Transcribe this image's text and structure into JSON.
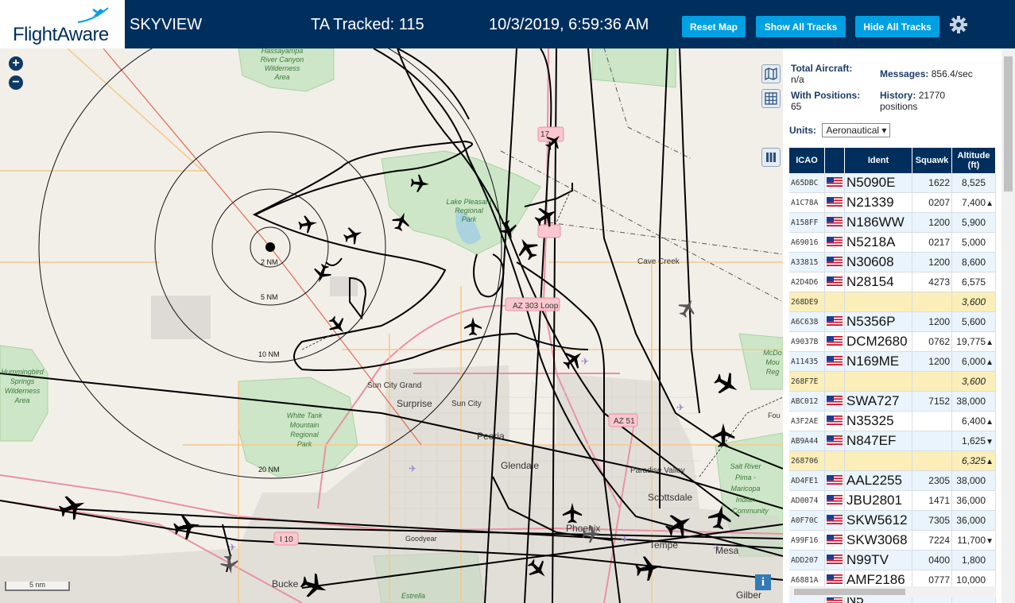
{
  "header": {
    "logo_text": "FlightAware",
    "app_name": "SKYVIEW",
    "tracked": "TA Tracked: 115",
    "datetime": "10/3/2019, 6:59:36 AM",
    "btn_reset": "Reset Map",
    "btn_show": "Show All Tracks",
    "btn_hide": "Hide All Tracks",
    "settings_icon": "gear-icon",
    "brand_color": "#002f5d",
    "button_color": "#00a0e2"
  },
  "map": {
    "zoom_in": "+",
    "zoom_out": "−",
    "scale_label": "5 nm",
    "info_label": "i",
    "ring_labels": [
      "2 NM",
      "5 NM",
      "10 NM",
      "20 NM"
    ],
    "places": {
      "hassayampa": [
        "Hassayampa",
        "River Canyon",
        "Wilderness",
        "Area"
      ],
      "lake_pleasant": [
        "Lake Pleasant",
        "Regional",
        "Park"
      ],
      "cave_creek": "Cave Creek",
      "az303": "AZ 303 Loop",
      "hummingbird": [
        "Hummingbird",
        "Springs",
        "Wilderness",
        "Area"
      ],
      "sun_city_grand": "Sun City Grand",
      "surprise": "Surprise",
      "sun_city": "Sun City",
      "white_tank": [
        "White Tank",
        "Mountain",
        "Regional",
        "Park"
      ],
      "peoria": "Peoria",
      "glendale": "Glendale",
      "az51": "AZ 51",
      "paradise_valley": "Paradise Valley",
      "scottsdale": "Scottsdale",
      "salt_river": [
        "Salt River",
        "Pima -",
        "Maricopa",
        "Indian",
        "Community"
      ],
      "phoenix": "Phoenix",
      "tempe": "Tempe",
      "mesa": "Mesa",
      "i10": "I 10",
      "goodyear": "Goodyear",
      "buckeye": "Bucke",
      "estrella": "Estrella",
      "gilbert": "Gilber",
      "mcdowell": [
        "McDo",
        "Mou",
        "Reg"
      ],
      "fountain": "Fou",
      "sr17": "17"
    }
  },
  "panel": {
    "total_aircraft_label": "Total Aircraft:",
    "total_aircraft_value": "n/a",
    "messages_label": "Messages:",
    "messages_value": "856.4/sec",
    "with_positions_label": "With Positions:",
    "with_positions_value": "65",
    "history_label": "History:",
    "history_value": "21770",
    "history_unit": "positions",
    "units_label": "Units:",
    "units_value": "Aeronautical",
    "columns": [
      "ICAO",
      "",
      "Ident",
      "Squawk",
      "Altitude (ft)"
    ],
    "rows": [
      {
        "icao": "A65DBC",
        "flag": true,
        "ident": "N5090E",
        "squawk": "1622",
        "alt": "8,525",
        "trend": "",
        "style": "blue"
      },
      {
        "icao": "A1C78A",
        "flag": true,
        "ident": "N21339",
        "squawk": "0207",
        "alt": "7,400",
        "trend": "▲",
        "style": "white"
      },
      {
        "icao": "A158FF",
        "flag": true,
        "ident": "N186WW",
        "squawk": "1200",
        "alt": "5,900",
        "trend": "",
        "style": "blue"
      },
      {
        "icao": "A69016",
        "flag": true,
        "ident": "N5218A",
        "squawk": "0217",
        "alt": "5,000",
        "trend": "",
        "style": "white"
      },
      {
        "icao": "A33815",
        "flag": true,
        "ident": "N30608",
        "squawk": "1200",
        "alt": "8,600",
        "trend": "",
        "style": "blue"
      },
      {
        "icao": "A2D4D6",
        "flag": true,
        "ident": "N28154",
        "squawk": "4273",
        "alt": "6,575",
        "trend": "",
        "style": "white"
      },
      {
        "icao": "268DE9",
        "flag": false,
        "ident": "",
        "squawk": "",
        "alt": "3,600",
        "trend": "",
        "style": "yel"
      },
      {
        "icao": "A6C638",
        "flag": true,
        "ident": "N5356P",
        "squawk": "1200",
        "alt": "5,600",
        "trend": "",
        "style": "blue"
      },
      {
        "icao": "A9037B",
        "flag": true,
        "ident": "DCM2680",
        "squawk": "0762",
        "alt": "19,775",
        "trend": "▲",
        "style": "white"
      },
      {
        "icao": "A11435",
        "flag": true,
        "ident": "N169ME",
        "squawk": "1200",
        "alt": "6,000",
        "trend": "▲",
        "style": "blue"
      },
      {
        "icao": "268F7E",
        "flag": false,
        "ident": "",
        "squawk": "",
        "alt": "3,600",
        "trend": "",
        "style": "yel"
      },
      {
        "icao": "ABC012",
        "flag": true,
        "ident": "SWA727",
        "squawk": "7152",
        "alt": "38,000",
        "trend": "",
        "style": "blue"
      },
      {
        "icao": "A3F2AE",
        "flag": true,
        "ident": "N35325",
        "squawk": "",
        "alt": "6,400",
        "trend": "▲",
        "style": "white"
      },
      {
        "icao": "AB9A44",
        "flag": true,
        "ident": "N847EF",
        "squawk": "",
        "alt": "1,625",
        "trend": "▼",
        "style": "blue"
      },
      {
        "icao": "268706",
        "flag": false,
        "ident": "",
        "squawk": "",
        "alt": "6,325",
        "trend": "▲",
        "style": "yel"
      },
      {
        "icao": "AD4FE1",
        "flag": true,
        "ident": "AAL2255",
        "squawk": "2305",
        "alt": "38,000",
        "trend": "",
        "style": "blue"
      },
      {
        "icao": "AD0074",
        "flag": true,
        "ident": "JBU2801",
        "squawk": "1471",
        "alt": "36,000",
        "trend": "",
        "style": "white"
      },
      {
        "icao": "A0F70C",
        "flag": true,
        "ident": "SKW5612",
        "squawk": "7305",
        "alt": "36,000",
        "trend": "",
        "style": "blue"
      },
      {
        "icao": "A99F16",
        "flag": true,
        "ident": "SKW3068",
        "squawk": "7224",
        "alt": "11,700",
        "trend": "▼",
        "style": "white"
      },
      {
        "icao": "ADD207",
        "flag": true,
        "ident": "N99TV",
        "squawk": "0400",
        "alt": "1,800",
        "trend": "",
        "style": "blue"
      },
      {
        "icao": "A6881A",
        "flag": true,
        "ident": "AMF2186",
        "squawk": "0777",
        "alt": "10,000",
        "trend": "",
        "style": "white"
      },
      {
        "icao": "",
        "flag": true,
        "ident": "N5 ",
        "squawk": "",
        "alt": "",
        "trend": "",
        "style": "blue"
      }
    ]
  }
}
